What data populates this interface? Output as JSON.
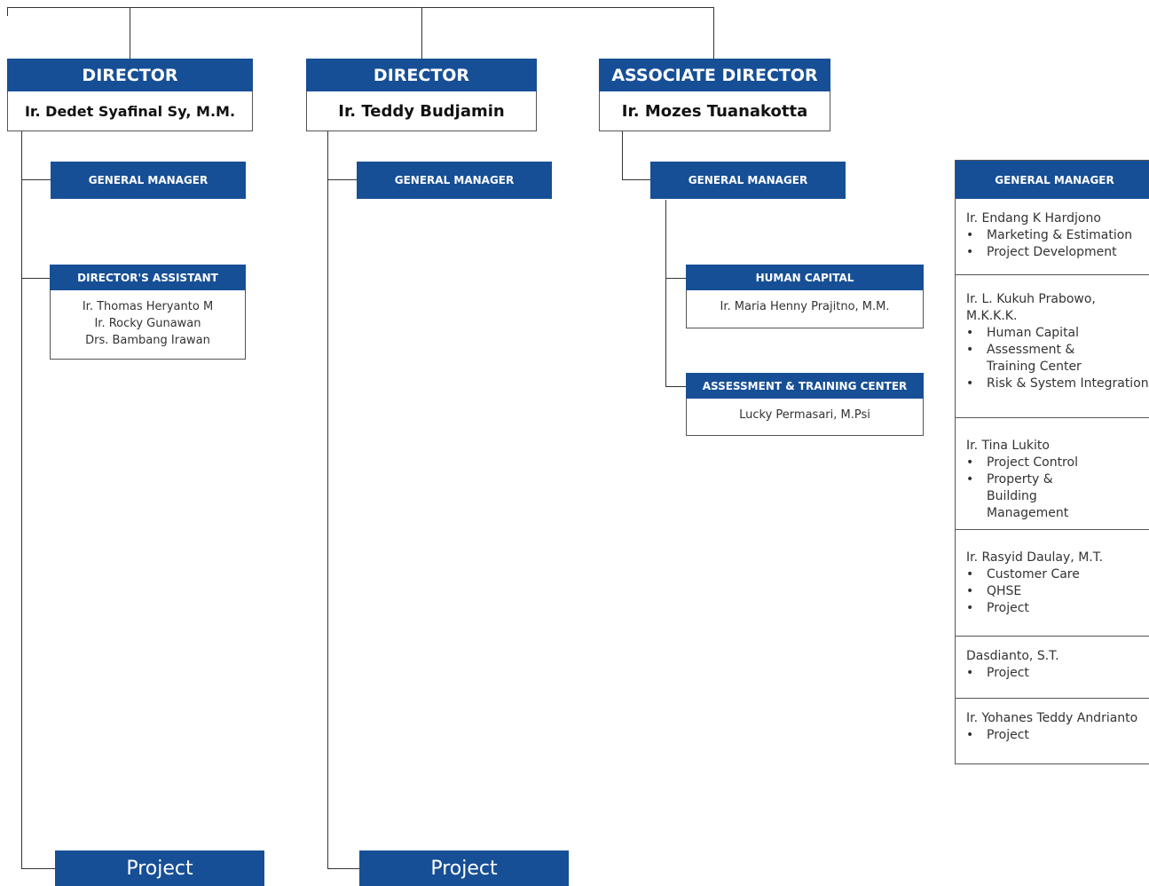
{
  "directors": [
    {
      "title": "DIRECTOR",
      "name": "Ir. Dedet Syafinal Sy, M.M."
    },
    {
      "title": "DIRECTOR",
      "name": "Ir. Teddy Budjamin"
    },
    {
      "title": "ASSOCIATE DIRECTOR",
      "name": "Ir. Mozes Tuanakotta"
    }
  ],
  "gm_label": "GENERAL MANAGER",
  "directors_assistant": {
    "title": "DIRECTOR'S ASSISTANT",
    "names": [
      "Ir. Thomas Heryanto M",
      "Ir. Rocky Gunawan",
      "Drs. Bambang Irawan"
    ]
  },
  "human_capital": {
    "title": "HUMAN CAPITAL",
    "name": "Ir. Maria Henny Prajitno, M.M."
  },
  "assessment_training": {
    "title": "ASSESSMENT & TRAINING CENTER",
    "name": "Lucky Permasari, M.Psi"
  },
  "project_label": "Project",
  "side_panel": {
    "title": "GENERAL MANAGER",
    "sections": [
      {
        "name": "Ir. Endang K Hardjono",
        "items": [
          "Marketing & Estimation",
          "Project Development"
        ]
      },
      {
        "name": "Ir. L. Kukuh Prabowo, M.K.K.K.",
        "items": [
          "Human Capital",
          "Assessment & Training Center",
          "Risk & System Integration"
        ]
      },
      {
        "name": "Ir. Tina Lukito",
        "items": [
          "Project Control",
          "Property & Building Management"
        ]
      },
      {
        "name": "Ir. Rasyid Daulay, M.T.",
        "items": [
          "Customer Care",
          "QHSE",
          "Project"
        ]
      },
      {
        "name": "Dasdianto, S.T.",
        "items": [
          "Project"
        ]
      },
      {
        "name": "Ir. Yohanes Teddy Andrianto",
        "items": [
          "Project"
        ]
      }
    ]
  },
  "colors": {
    "header_blue": "#174f96",
    "line": "#333333"
  }
}
